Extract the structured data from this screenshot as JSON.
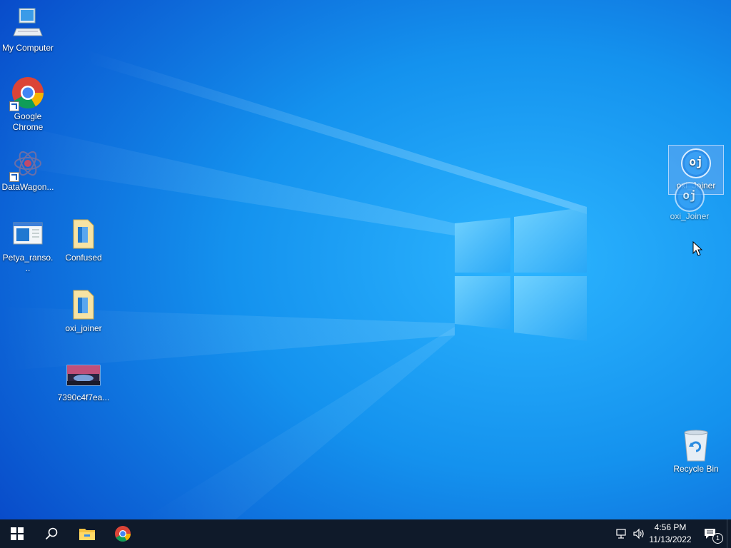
{
  "desktop": {
    "icons": {
      "my_computer": "My Computer",
      "google_chrome": "Google Chrome",
      "datawagon": "DataWagon...",
      "petya": "Petya_ranso...",
      "confused": "Confused",
      "oxi_joiner_folder": "oxi_joiner",
      "image_file": "7390c4f7ea...",
      "oxi_joiner_app": "oxi_Joiner",
      "oxi_joiner_drag": "oxi_Joiner",
      "recycle_bin": "Recycle Bin"
    },
    "oxi_badge": "oj"
  },
  "taskbar": {
    "clock_time": "4:56 PM",
    "clock_date": "11/13/2022",
    "notification_count": "1"
  },
  "colors": {
    "wallpaper_light": "#1e9bf0",
    "wallpaper_dark": "#0a4fd0",
    "taskbar": "#0f1a2a"
  },
  "icons": [
    "windows-start-icon",
    "search-icon",
    "file-explorer-icon",
    "chrome-icon",
    "network-icon",
    "volume-icon",
    "action-center-icon"
  ]
}
